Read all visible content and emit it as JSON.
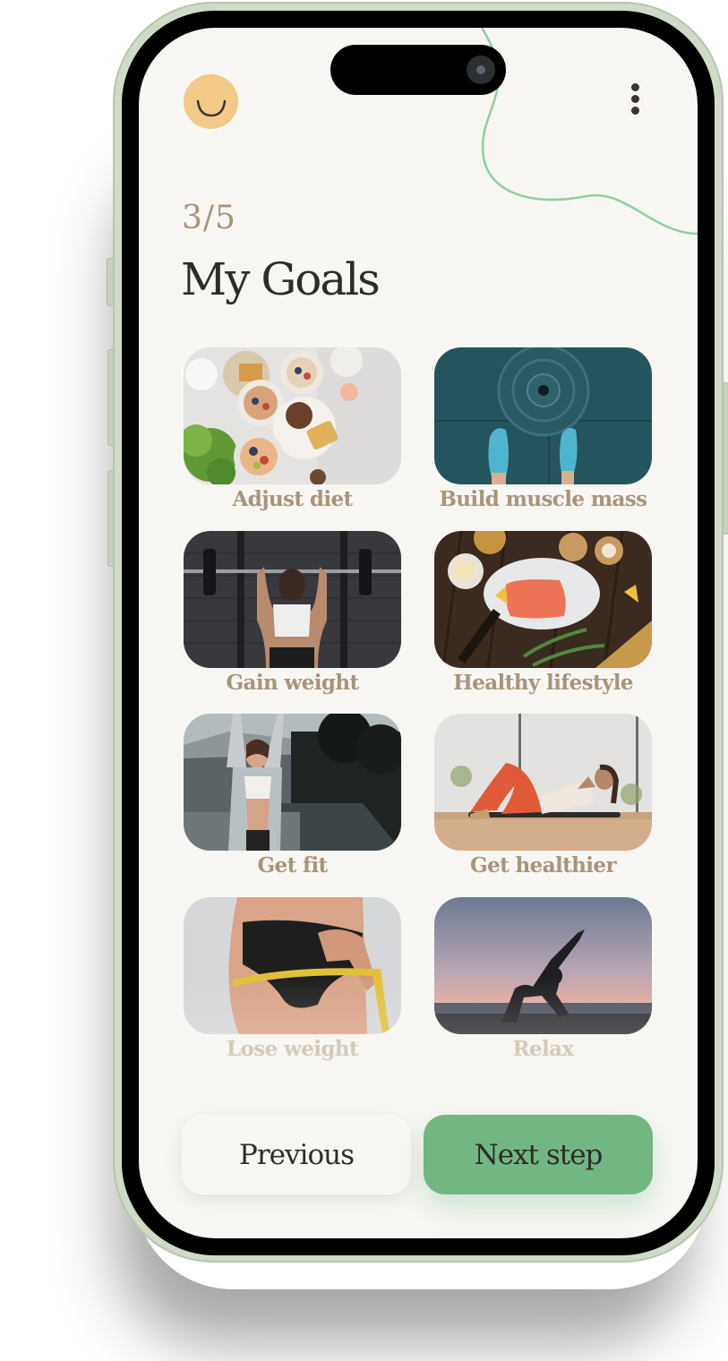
{
  "header": {
    "avatar_icon": "smiley-face-icon",
    "menu_icon": "vertical-ellipsis-icon"
  },
  "progress": {
    "step_text": "3/5",
    "current": 3,
    "total": 5
  },
  "page": {
    "title": "My Goals"
  },
  "goals": [
    {
      "label": "Adjust diet",
      "image": "healthy breakfast bowls on marble table"
    },
    {
      "label": "Build muscle mass",
      "image": "feet in blue sneakers beside weight plate"
    },
    {
      "label": "Gain weight",
      "image": "woman lifting barbell at squat rack"
    },
    {
      "label": "Healthy lifestyle",
      "image": "salmon fillet on plate with lemon and herbs"
    },
    {
      "label": "Get fit",
      "image": "woman stretching arms up outdoors"
    },
    {
      "label": "Get healthier",
      "image": "woman doing crunches on yoga mat"
    },
    {
      "label": "Lose weight",
      "image": "measuring tape around hips"
    },
    {
      "label": "Relax",
      "image": "yoga pose silhouette at sunset"
    }
  ],
  "footer": {
    "previous_label": "Previous",
    "next_label": "Next step"
  },
  "colors": {
    "accent_green": "#72b783",
    "label_tan": "#a89479",
    "avatar_yellow": "#f2c987",
    "screen_bg": "#f7f6f3",
    "text_dark": "#2f2b2a"
  }
}
